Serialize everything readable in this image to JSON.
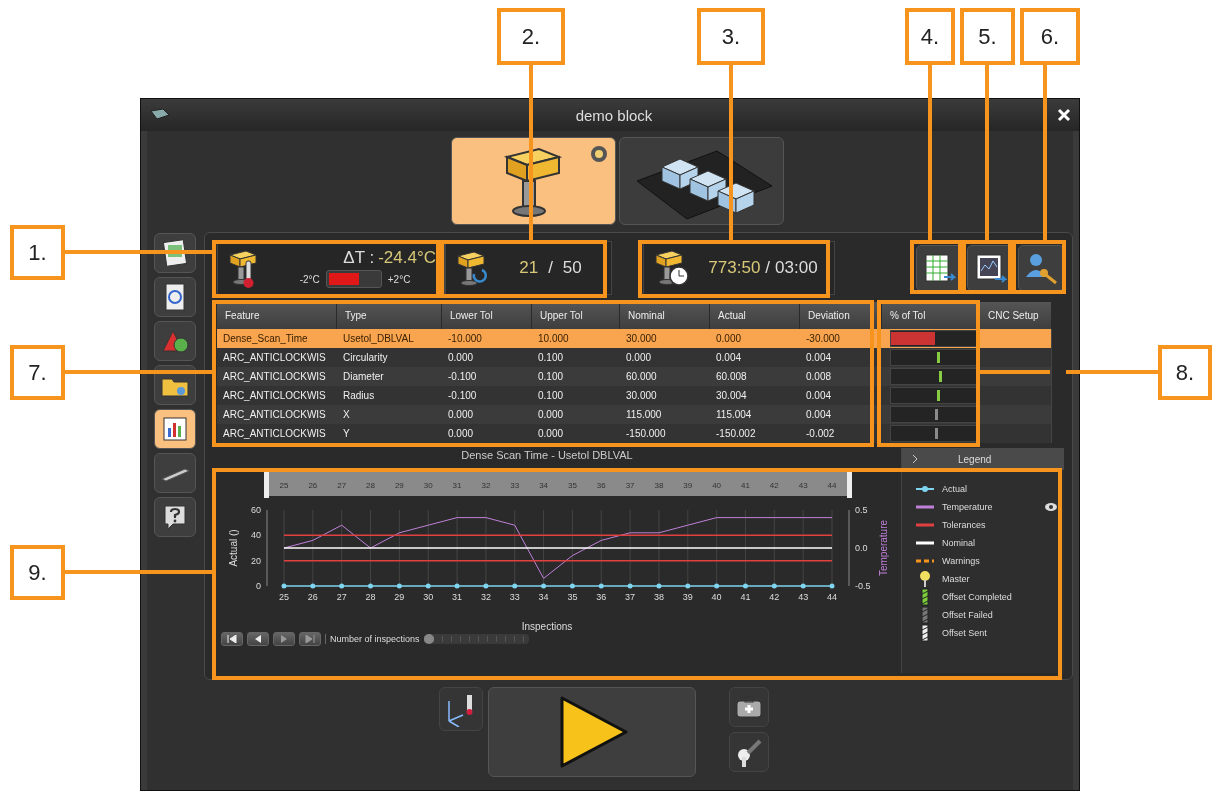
{
  "window": {
    "title": "demo block"
  },
  "mode_tabs": [
    {
      "selected": true,
      "indicator": true
    },
    {
      "selected": false,
      "indicator": false
    }
  ],
  "sidebar": {
    "items": [
      {
        "selected": false
      },
      {
        "selected": false
      },
      {
        "selected": false
      },
      {
        "selected": false
      },
      {
        "selected": true
      },
      {
        "selected": false
      },
      {
        "selected": false
      }
    ]
  },
  "temperature": {
    "label": "ΔT :",
    "value": "-24.4°C",
    "min": "-2°C",
    "max": "+2°C",
    "level": 0.6
  },
  "count": {
    "done": "21",
    "separator": "/",
    "total": "50"
  },
  "time": {
    "elapsed": "773:50",
    "separator": "/",
    "total": "03:00"
  },
  "table": {
    "columns": [
      "Feature",
      "Type",
      "Lower Tol",
      "Upper Tol",
      "Nominal",
      "Actual",
      "Deviation",
      "% of Tol",
      "CNC Setup"
    ],
    "rows": [
      {
        "selected": true,
        "cells": [
          "Dense_Scan_Time",
          "Usetol_DBLVAL",
          "-10.000",
          "10.000",
          "30.000",
          "0.000",
          "-30.000"
        ],
        "tol": {
          "kind": "fill",
          "level": 0.5,
          "color": "#cc3333"
        }
      },
      {
        "selected": false,
        "cells": [
          "ARC_ANTICLOCKWIS",
          "Circularity",
          "0.000",
          "0.100",
          "0.000",
          "0.004",
          "0.004"
        ],
        "tol": {
          "kind": "tick",
          "level": 0.52,
          "color": "#88cc44"
        }
      },
      {
        "selected": false,
        "cells": [
          "ARC_ANTICLOCKWIS",
          "Diameter",
          "-0.100",
          "0.100",
          "60.000",
          "60.008",
          "0.008"
        ],
        "tol": {
          "kind": "tick",
          "level": 0.54,
          "color": "#88cc44"
        }
      },
      {
        "selected": false,
        "cells": [
          "ARC_ANTICLOCKWIS",
          "Radius",
          "-0.100",
          "0.100",
          "30.000",
          "30.004",
          "0.004"
        ],
        "tol": {
          "kind": "tick",
          "level": 0.52,
          "color": "#88cc44"
        }
      },
      {
        "selected": false,
        "cells": [
          "ARC_ANTICLOCKWIS",
          "X",
          "0.000",
          "0.000",
          "115.000",
          "115.004",
          "0.004"
        ],
        "tol": {
          "kind": "tick",
          "level": 0.5,
          "color": "#8a8a8a"
        }
      },
      {
        "selected": false,
        "cells": [
          "ARC_ANTICLOCKWIS",
          "Y",
          "0.000",
          "0.000",
          "-150.000",
          "-150.002",
          "-0.002"
        ],
        "tol": {
          "kind": "tick",
          "level": 0.5,
          "color": "#8a8a8a"
        }
      }
    ]
  },
  "chart": {
    "right_axis_title": "Temperature",
    "navigator_labels": [
      "25",
      "26",
      "27",
      "28",
      "29",
      "30",
      "31",
      "32",
      "33",
      "34",
      "35",
      "36",
      "37",
      "38",
      "39",
      "40",
      "41",
      "42",
      "43",
      "44"
    ],
    "chart_data": {
      "type": "line",
      "title": "Dense  Scan  Time - Usetol  DBLVAL",
      "xlabel": "Inspections",
      "ylabel": "Actual ()",
      "categories": [
        "25",
        "26",
        "27",
        "28",
        "29",
        "30",
        "31",
        "32",
        "33",
        "34",
        "35",
        "36",
        "37",
        "38",
        "39",
        "40",
        "41",
        "42",
        "43",
        "44"
      ],
      "ylim": [
        0,
        60
      ],
      "yticks": [
        0,
        20,
        40,
        60
      ],
      "y2lim": [
        -0.5,
        0.5
      ],
      "y2ticks": [
        {
          "value": -0.5,
          "label": "-0.5"
        },
        {
          "value": 0,
          "label": "0.0"
        },
        {
          "value": 0.5,
          "label": "0.5"
        }
      ],
      "series": [
        {
          "name": "Actual",
          "color": "#7fd4f0",
          "values": [
            0,
            0,
            0,
            0,
            0,
            0,
            0,
            0,
            0,
            0,
            0,
            0,
            0,
            0,
            0,
            0,
            0,
            0,
            0,
            0
          ]
        },
        {
          "name": "Temperature",
          "color": "#c080d8",
          "axis": "y2",
          "values": [
            0.0,
            0.1,
            0.3,
            0.0,
            0.2,
            0.3,
            0.4,
            0.4,
            0.3,
            -0.4,
            -0.1,
            0.1,
            0.2,
            0.2,
            0.3,
            0.4,
            0.4,
            0.4,
            0.4,
            0.4
          ]
        },
        {
          "name": "Tolerances",
          "color": "#e04040",
          "values": [
            40,
            40,
            40,
            40,
            40,
            40,
            40,
            40,
            40,
            40,
            40,
            40,
            40,
            40,
            40,
            40,
            40,
            40,
            40,
            40
          ]
        },
        {
          "name": "Nominal",
          "color": "#ffffff",
          "values": [
            30,
            30,
            30,
            30,
            30,
            30,
            30,
            30,
            30,
            30,
            30,
            30,
            30,
            30,
            30,
            30,
            30,
            30,
            30,
            30
          ]
        },
        {
          "color": "#e04040",
          "values": [
            20,
            20,
            20,
            20,
            20,
            20,
            20,
            20,
            20,
            20,
            20,
            20,
            20,
            20,
            20,
            20,
            20,
            20,
            20,
            20
          ]
        }
      ],
      "grid": true
    },
    "player": {
      "label": "Number of inspections",
      "level": 0.0
    }
  },
  "legend": {
    "title": "Legend",
    "items": [
      {
        "kind": "dotline",
        "eye": false
      },
      {
        "kind": "line",
        "eye": true
      },
      {
        "kind": "line",
        "eye": false
      },
      {
        "kind": "line",
        "eye": false
      },
      {
        "kind": "dash",
        "color": "#f7941d",
        "label": "Warnings",
        "eye": false
      },
      {
        "kind": "pin",
        "color": "#f0e060",
        "label": "Master",
        "eye": false
      },
      {
        "kind": "stripe",
        "color": "#7ccf3a",
        "label": "Offset Completed",
        "eye": false
      },
      {
        "kind": "stripe",
        "color": "#777777",
        "label": "Offset Failed",
        "eye": false
      },
      {
        "kind": "stripe",
        "color": "#eeeeee",
        "label": "Offset Sent",
        "eye": false
      }
    ]
  },
  "callouts": [
    {
      "label": "1."
    },
    {
      "label": "2."
    },
    {
      "label": "3."
    },
    {
      "label": "4."
    },
    {
      "label": "5."
    },
    {
      "label": "6."
    },
    {
      "label": "7."
    },
    {
      "label": "8."
    },
    {
      "label": "9."
    }
  ]
}
